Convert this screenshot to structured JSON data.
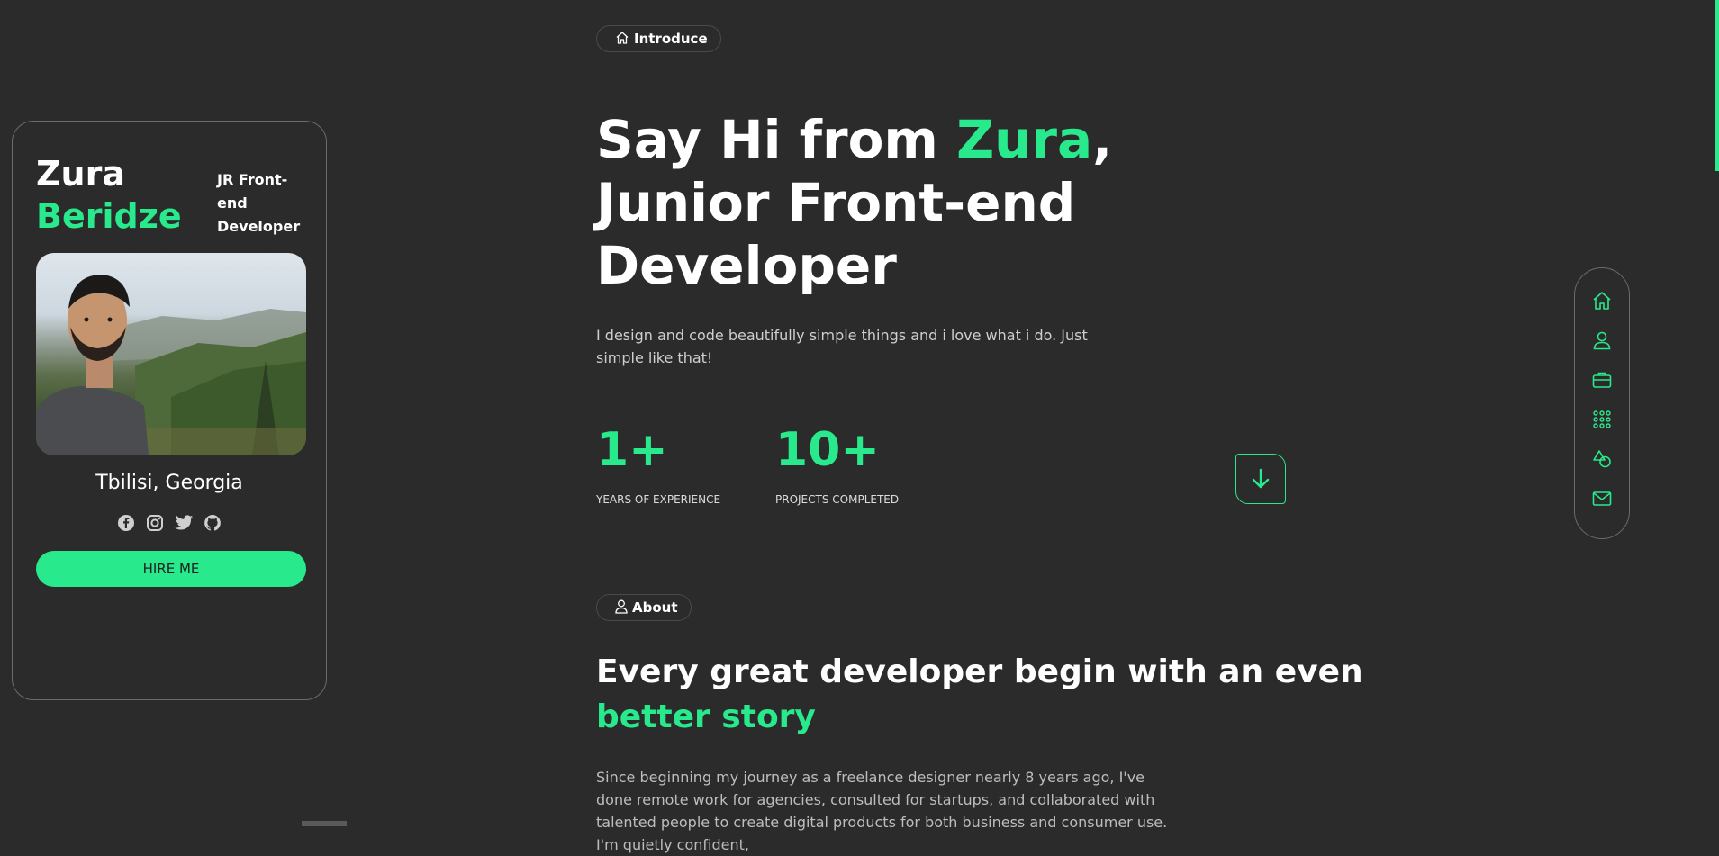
{
  "profile": {
    "first_name": "Zura",
    "last_name": "Beridze",
    "role": "JR Front-end Developer",
    "location": "Tbilisi, Georgia",
    "socials": [
      "facebook-icon",
      "instagram-icon",
      "twitter-icon",
      "github-icon"
    ],
    "hire_label": "HIRE ME"
  },
  "intro": {
    "badge": "Introduce",
    "title_pre": "Say Hi from ",
    "title_name": "Zura",
    "title_post": ",",
    "title_line2": "Junior Front-end",
    "title_line3": "Developer",
    "description": "I design and code beautifully simple things and i love what i do. Just simple like that!",
    "stats": [
      {
        "value": "1+",
        "label": "YEARS OF EXPERIENCE"
      },
      {
        "value": "10+",
        "label": "PROJECTS COMPLETED"
      }
    ]
  },
  "about": {
    "badge": "About",
    "title_line1": "Every great developer begin with an even",
    "title_line2": "better story",
    "text": "Since beginning my journey as a freelance designer nearly 8 years ago, I've done remote work for agencies, consulted for startups, and collaborated with talented people to create digital products for both business and consumer use. I'm quietly confident,"
  },
  "nav": [
    "home-icon",
    "user-icon",
    "briefcase-icon",
    "grid-icon",
    "shapes-icon",
    "mail-icon"
  ],
  "colors": {
    "accent": "#28e98c",
    "background": "#2b2b2b",
    "border": "#6b6b6b"
  }
}
